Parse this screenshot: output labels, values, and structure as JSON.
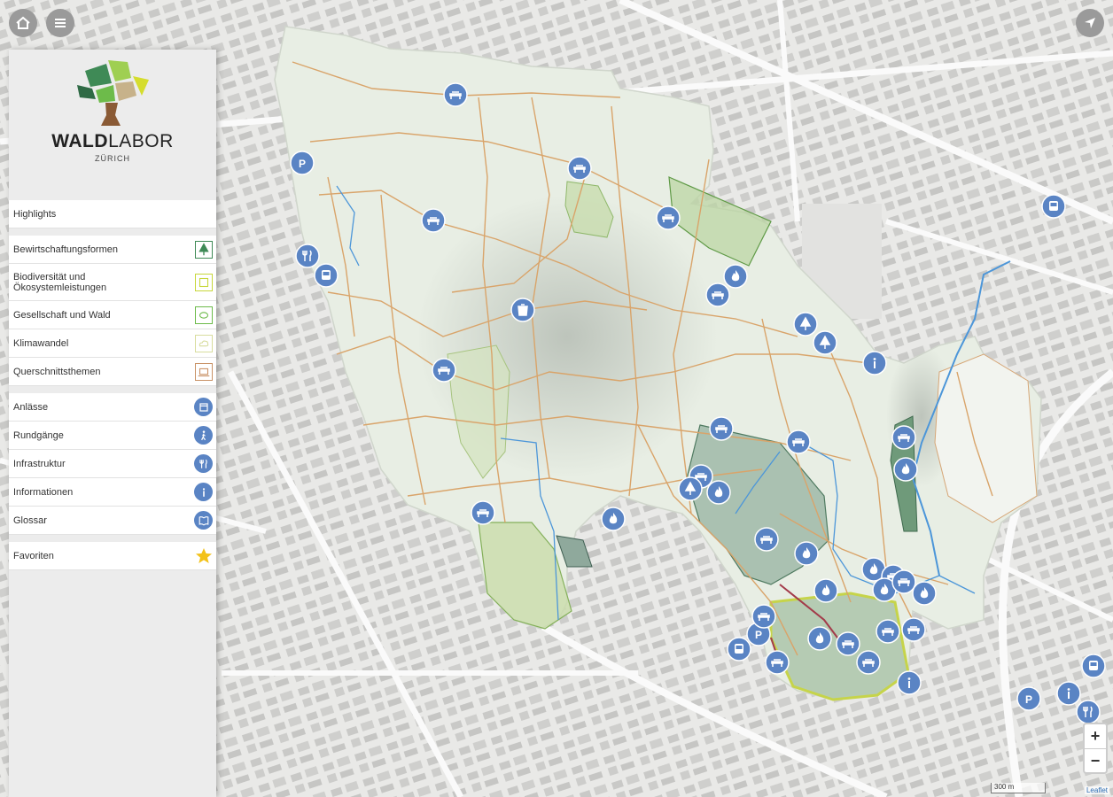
{
  "brand": {
    "bold": "WALD",
    "light": "LABOR",
    "sub": "ZÜRICH"
  },
  "menu": {
    "highlights": "Highlights",
    "themes": [
      {
        "label": "Bewirtschaftungsformen",
        "color": "#3f8a56",
        "icon": "tree-icon"
      },
      {
        "label": "Biodiversität und Ökosystemleistungen",
        "color": "#c7d73a",
        "icon": "flower-icon"
      },
      {
        "label": "Gesellschaft und Wald",
        "color": "#6dbb4a",
        "icon": "people-icon"
      },
      {
        "label": "Klimawandel",
        "color": "#d8dd9e",
        "icon": "cloud-icon"
      },
      {
        "label": "Querschnittsthemen",
        "color": "#c99266",
        "icon": "laptop-icon"
      }
    ],
    "sections": [
      {
        "label": "Anlässe",
        "icon": "calendar-icon"
      },
      {
        "label": "Rundgänge",
        "icon": "walker-icon"
      },
      {
        "label": "Infrastruktur",
        "icon": "cutlery-icon"
      },
      {
        "label": "Informationen",
        "icon": "info-icon"
      },
      {
        "label": "Glossar",
        "icon": "book-icon"
      }
    ],
    "favorites": "Favoriten"
  },
  "map": {
    "scale": "300 m",
    "attribution": "Leaflet",
    "marker_color": "#5a84c4",
    "forest_color": "#e6ece2",
    "path_color": "#d9a46a"
  },
  "markers": [
    {
      "icon": "bench-icon"
    },
    {
      "icon": "parking-icon"
    },
    {
      "icon": "bench-icon"
    },
    {
      "icon": "bench-icon"
    },
    {
      "icon": "bench-icon"
    },
    {
      "icon": "cutlery-icon"
    },
    {
      "icon": "bus-icon"
    },
    {
      "icon": "bin-icon"
    },
    {
      "icon": "fire-icon"
    },
    {
      "icon": "bench-icon"
    },
    {
      "icon": "tree-icon"
    },
    {
      "icon": "tree-icon"
    },
    {
      "icon": "info-icon"
    },
    {
      "icon": "bench-icon"
    },
    {
      "icon": "bench-icon"
    },
    {
      "icon": "bench-icon"
    },
    {
      "icon": "bus-icon"
    },
    {
      "icon": "bench-icon"
    },
    {
      "icon": "fire-icon"
    },
    {
      "icon": "bench-icon"
    },
    {
      "icon": "tree-icon"
    },
    {
      "icon": "fire-icon"
    },
    {
      "icon": "bench-icon"
    },
    {
      "icon": "fire-icon"
    },
    {
      "icon": "bench-icon"
    },
    {
      "icon": "fire-icon"
    },
    {
      "icon": "fire-icon"
    },
    {
      "icon": "bench-icon"
    },
    {
      "icon": "fire-icon"
    },
    {
      "icon": "fire-icon"
    },
    {
      "icon": "bench-icon"
    },
    {
      "icon": "fire-icon"
    },
    {
      "icon": "fire-icon"
    },
    {
      "icon": "bench-icon"
    },
    {
      "icon": "bench-icon"
    },
    {
      "icon": "bench-icon"
    },
    {
      "icon": "bench-icon"
    },
    {
      "icon": "parking-icon"
    },
    {
      "icon": "bench-icon"
    },
    {
      "icon": "bus-icon"
    },
    {
      "icon": "bench-icon"
    },
    {
      "icon": "info-icon"
    },
    {
      "icon": "parking-icon"
    },
    {
      "icon": "info-icon"
    },
    {
      "icon": "bus-icon"
    },
    {
      "icon": "cutlery-icon"
    }
  ]
}
